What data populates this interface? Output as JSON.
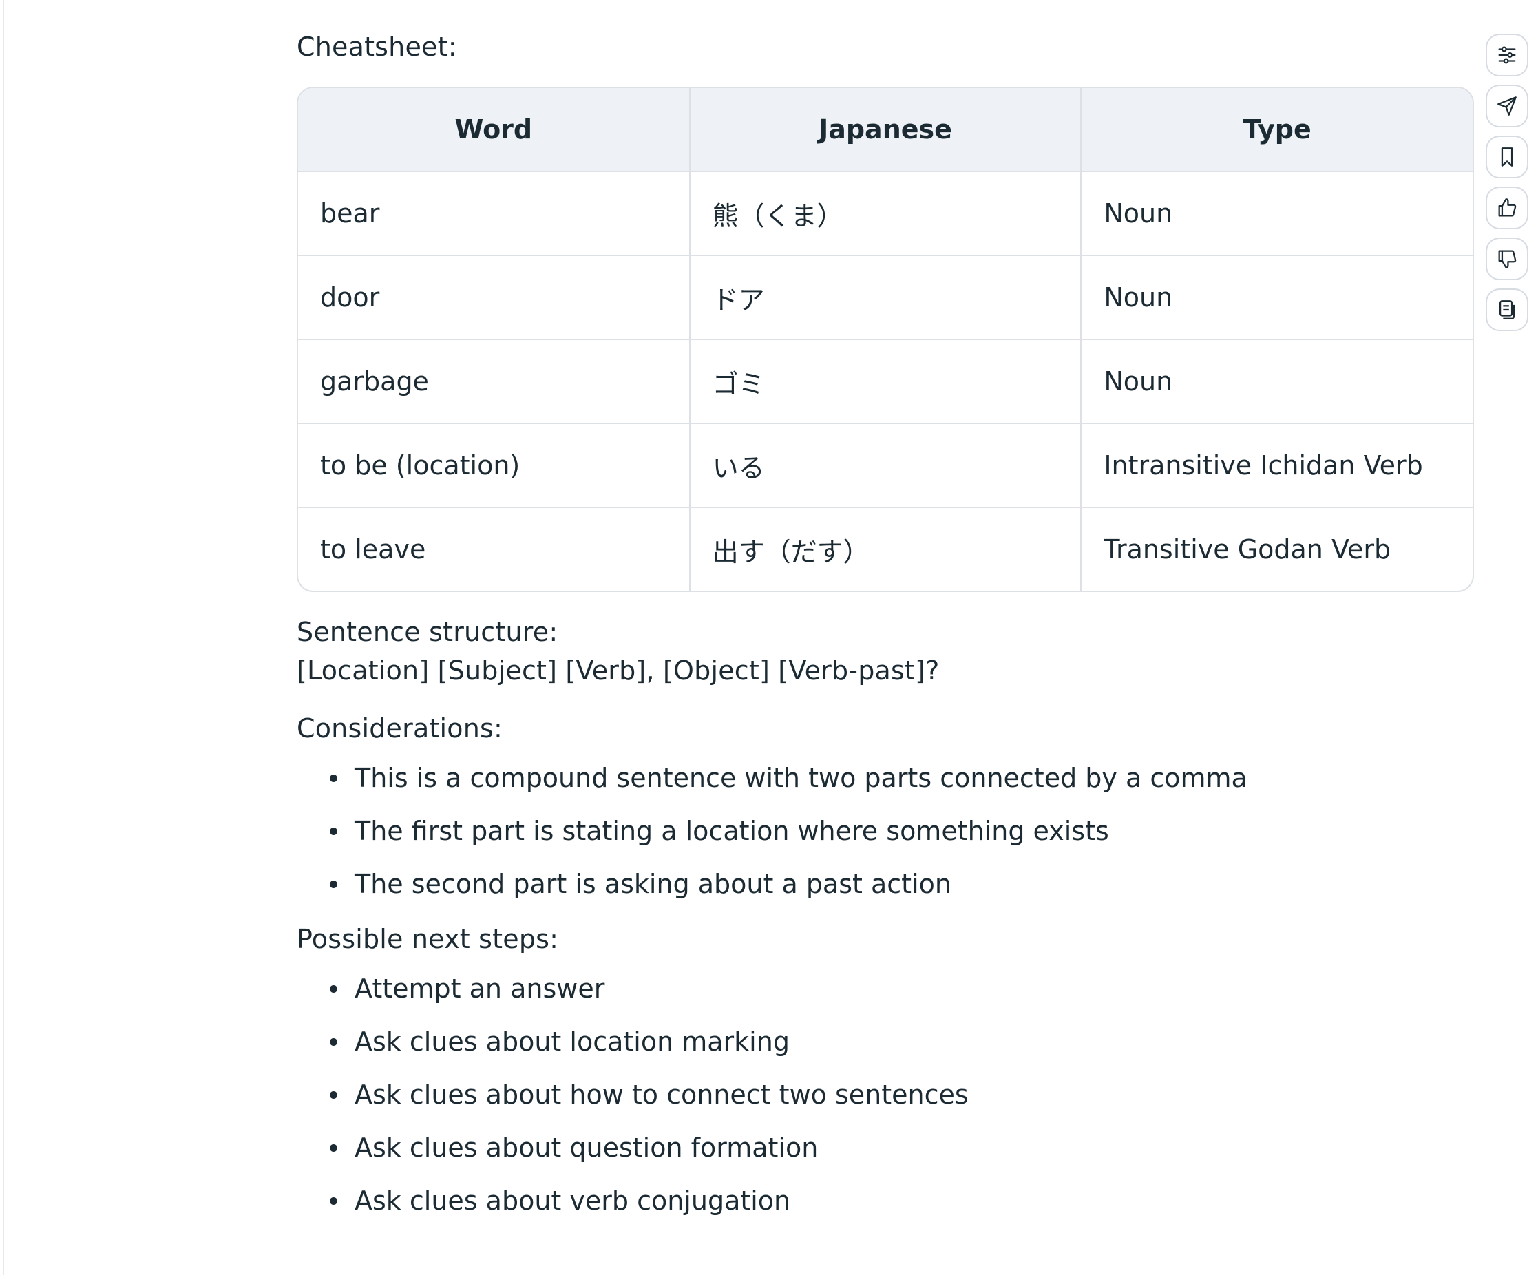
{
  "cheatsheet": {
    "label": "Cheatsheet:",
    "columns": [
      "Word",
      "Japanese",
      "Type"
    ],
    "rows": [
      [
        "bear",
        "熊（くま）",
        "Noun"
      ],
      [
        "door",
        "ドア",
        "Noun"
      ],
      [
        "garbage",
        "ゴミ",
        "Noun"
      ],
      [
        "to be (location)",
        "いる",
        "Intransitive Ichidan Verb"
      ],
      [
        "to leave",
        "出す（だす）",
        "Transitive Godan Verb"
      ]
    ]
  },
  "structure": {
    "label": "Sentence structure:",
    "pattern": "[Location] [Subject] [Verb], [Object] [Verb-past]?"
  },
  "considerations": {
    "label": "Considerations:",
    "items": [
      "This is a compound sentence with two parts connected by a comma",
      "The first part is stating a location where something exists",
      "The second part is asking about a past action"
    ]
  },
  "next_steps": {
    "label": "Possible next steps:",
    "items": [
      "Attempt an answer",
      "Ask clues about location marking",
      "Ask clues about how to connect two sentences",
      "Ask clues about question formation",
      "Ask clues about verb conjugation"
    ]
  },
  "action_bar": {
    "icons": [
      "sliders-icon",
      "send-icon",
      "bookmark-icon",
      "thumbs-up-icon",
      "thumbs-down-icon",
      "copy-icon"
    ]
  },
  "colors": {
    "text": "#1c2b33",
    "header_bg": "#eef2f7",
    "border": "#dde1e6"
  }
}
